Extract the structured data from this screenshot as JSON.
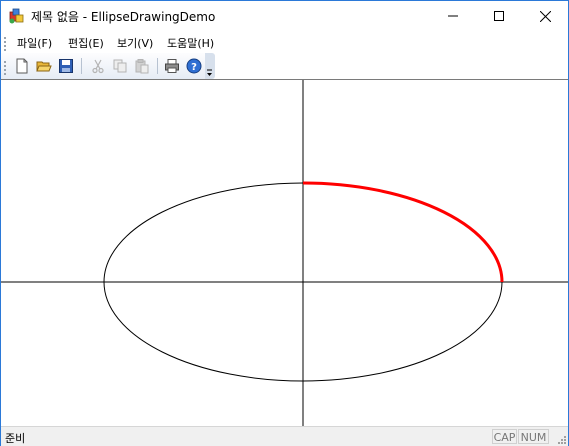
{
  "window": {
    "title": "제목 없음 - EllipseDrawingDemo",
    "minimize_icon": "minimize-icon",
    "maximize_icon": "maximize-icon",
    "close_icon": "close-icon",
    "app_icon": "mfc-app-icon"
  },
  "menubar": {
    "items": [
      {
        "label": "파일(F)"
      },
      {
        "label": "편집(E)"
      },
      {
        "label": "보기(V)"
      },
      {
        "label": "도움말(H)"
      }
    ]
  },
  "toolbar": {
    "buttons": [
      {
        "name": "new",
        "icon": "new-file-icon",
        "enabled": true
      },
      {
        "name": "open",
        "icon": "open-folder-icon",
        "enabled": true
      },
      {
        "name": "save",
        "icon": "save-disk-icon",
        "enabled": true
      },
      {
        "name": "cut",
        "icon": "cut-icon",
        "enabled": false
      },
      {
        "name": "copy",
        "icon": "copy-icon",
        "enabled": false
      },
      {
        "name": "paste",
        "icon": "paste-icon",
        "enabled": false
      },
      {
        "name": "print",
        "icon": "print-icon",
        "enabled": true
      },
      {
        "name": "about",
        "icon": "help-icon",
        "enabled": true
      }
    ]
  },
  "drawing": {
    "shape": "ellipse with axes",
    "ellipse_color": "#000000",
    "highlight_arc_color": "#ff0000",
    "axis_color": "#000000"
  },
  "statusbar": {
    "text": "준비",
    "panes": [
      "CAP",
      "NUM"
    ]
  }
}
